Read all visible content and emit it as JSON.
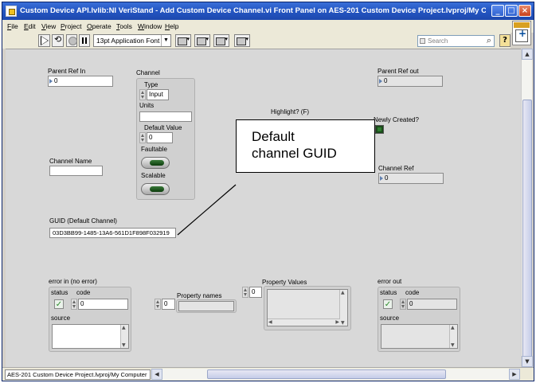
{
  "window": {
    "title": "Custom Device API.lvlib:NI VeriStand - Add Custom Device Channel.vi Front Panel on AES-201 Custom Device Project.lvproj/My Comp..."
  },
  "menu": [
    "File",
    "Edit",
    "View",
    "Project",
    "Operate",
    "Tools",
    "Window",
    "Help"
  ],
  "toolbar": {
    "font": "13pt Application Font",
    "search_placeholder": "Search",
    "help": "?"
  },
  "panel": {
    "parent_ref_in": {
      "label": "Parent Ref In",
      "value": "0"
    },
    "channel": {
      "label": "Channel",
      "type_label": "Type",
      "type_value": "Input",
      "units_label": "Units",
      "units_value": "",
      "default_value_label": "Default Value",
      "default_value": "0",
      "faultable_label": "Faultable",
      "scalable_label": "Scalable"
    },
    "channel_name": {
      "label": "Channel Name",
      "value": ""
    },
    "highlight": {
      "label": "Highlight? (F)"
    },
    "parent_ref_out": {
      "label": "Parent Ref out",
      "value": "0"
    },
    "newly_created": {
      "label": "Newly Created?"
    },
    "channel_ref": {
      "label": "Channel Ref",
      "value": "0"
    },
    "guid": {
      "label": "GUID (Default Channel)",
      "value": "03D3BB99-1485-13A6-561D1F898F032919"
    },
    "callout": {
      "line1": "Default",
      "line2": "channel GUID"
    },
    "error_in": {
      "label": "error in (no error)",
      "status_label": "status",
      "code_label": "code",
      "code": "0",
      "source_label": "source"
    },
    "property_names": {
      "label": "Property names",
      "index": "0"
    },
    "property_values": {
      "label": "Property Values",
      "index": "0"
    },
    "error_out": {
      "label": "error out",
      "status_label": "status",
      "code_label": "code",
      "code": "0",
      "source_label": "source"
    }
  },
  "statusbar": {
    "path": "AES-201 Custom Device Project.lvproj/My Computer"
  }
}
